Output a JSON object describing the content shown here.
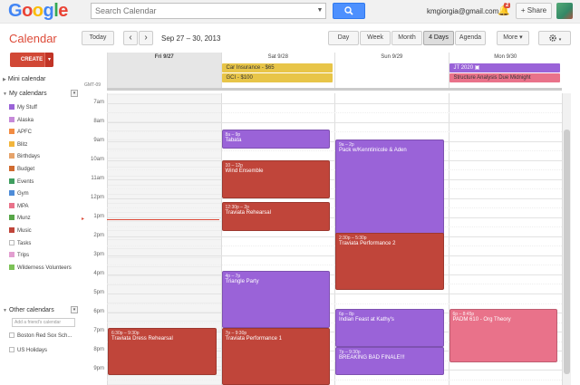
{
  "colors": {
    "purple": "#9a63d8",
    "red": "#c0453a",
    "pink": "#e9728a",
    "gold": "#e8c548",
    "accent": "#dd4b39"
  },
  "topbar": {
    "search_placeholder": "Search Calendar",
    "search_icon": "search-icon",
    "email": "kmgiorgia@gmail.com",
    "notification_count": "2",
    "share_label": "+ Share"
  },
  "toolbar": {
    "app_name": "Calendar",
    "today_label": "Today",
    "prev": "‹",
    "next": "›",
    "date_range": "Sep 27 – 30, 2013",
    "views": [
      "Day",
      "Week",
      "Month",
      "4 Days",
      "Agenda"
    ],
    "active_view": "4 Days",
    "more_label": "More ▾",
    "settings_icon": "gear-icon"
  },
  "sidebar": {
    "create_label": "CREATE",
    "mini_calendar_label": "Mini calendar",
    "my_calendars_label": "My calendars",
    "my_calendars": [
      {
        "name": "My Stuff",
        "color": "#9a63d8"
      },
      {
        "name": "Alaska",
        "color": "#c68ad9"
      },
      {
        "name": "APFC",
        "color": "#f28c43"
      },
      {
        "name": "Blitz",
        "color": "#f2b53b"
      },
      {
        "name": "Birthdays",
        "color": "#e6a36a"
      },
      {
        "name": "Budget",
        "color": "#d06b30"
      },
      {
        "name": "Events",
        "color": "#3f9e5f"
      },
      {
        "name": "Gym",
        "color": "#4e8cd8"
      },
      {
        "name": "MPA",
        "color": "#e9728a"
      },
      {
        "name": "Munz",
        "color": "#57a648"
      },
      {
        "name": "Music",
        "color": "#c0453a"
      },
      {
        "name": "Tasks",
        "color": ""
      },
      {
        "name": "Trips",
        "color": "#e29ed0"
      },
      {
        "name": "Wilderness Volunteers",
        "color": "#7cc257"
      }
    ],
    "other_calendars_label": "Other calendars",
    "friend_placeholder": "Add a friend's calendar",
    "other_calendars": [
      {
        "name": "Boston Red Sox Sch..."
      },
      {
        "name": "US Holidays"
      }
    ]
  },
  "calendar": {
    "gmt_label": "GMT-09",
    "days": [
      {
        "label": "Fri 9/27",
        "today": true
      },
      {
        "label": "Sat 9/28",
        "today": false
      },
      {
        "label": "Sun 9/29",
        "today": false
      },
      {
        "label": "Mon 9/30",
        "today": false
      }
    ],
    "allday_events": [
      {
        "day": 1,
        "row": 0,
        "title": "Car Insurance - $65",
        "color": "#e8c548",
        "text": "#333"
      },
      {
        "day": 1,
        "row": 1,
        "title": "GCI - $100",
        "color": "#e8c548",
        "text": "#333"
      },
      {
        "day": 3,
        "row": 0,
        "title": "JT 2020 ▣",
        "color": "#9a63d8",
        "text": "#fff"
      },
      {
        "day": 3,
        "row": 1,
        "title": "Structure Analysis Due Midnight",
        "color": "#e9728a",
        "text": "#333"
      }
    ],
    "hours": [
      "7am",
      "8am",
      "9am",
      "10am",
      "11am",
      "12pm",
      "1pm",
      "2pm",
      "3pm",
      "4pm",
      "5pm",
      "6pm",
      "7pm",
      "8pm",
      "9pm"
    ],
    "start_hour": 6.5,
    "end_hour": 21.8,
    "now_hour": 13.1,
    "events": [
      {
        "day": 1,
        "start": 8.4,
        "end": 9.4,
        "time": "8a – 9p",
        "title": "Tabata",
        "color": "#9a63d8"
      },
      {
        "day": 2,
        "start": 8.9,
        "end": 14.0,
        "time": "9a – 2p",
        "title": "Pack w/Kenntinicole & Aden",
        "color": "#9a63d8"
      },
      {
        "day": 1,
        "start": 10.0,
        "end": 12.0,
        "time": "10 – 12p",
        "title": "Wind Ensemble",
        "color": "#c0453a"
      },
      {
        "day": 1,
        "start": 12.2,
        "end": 13.7,
        "time": "12:30p – 2p",
        "title": "Traviata Rehearsal",
        "color": "#c0453a"
      },
      {
        "day": 2,
        "start": 13.8,
        "end": 16.8,
        "time": "2:30p – 5:30p",
        "title": "Traviata Performance 2",
        "color": "#c0453a"
      },
      {
        "day": 1,
        "start": 15.8,
        "end": 18.8,
        "time": "4p – 7p",
        "title": "Triangle Party",
        "color": "#9a63d8"
      },
      {
        "day": 2,
        "start": 17.8,
        "end": 19.8,
        "time": "6p – 8p",
        "title": "Indian Feast at Kathy's",
        "color": "#9a63d8"
      },
      {
        "day": 3,
        "start": 17.8,
        "end": 20.6,
        "time": "6p – 8:45p",
        "title": "PADM 610 - Org Theory",
        "color": "#e9728a"
      },
      {
        "day": 0,
        "start": 18.8,
        "end": 21.3,
        "time": "6:30p – 9:30p",
        "title": "Traviata Dress Rehearsal",
        "color": "#c0453a"
      },
      {
        "day": 1,
        "start": 18.8,
        "end": 21.8,
        "time": "7p – 9:30p",
        "title": "Traviata Performance 1",
        "color": "#c0453a"
      },
      {
        "day": 2,
        "start": 19.8,
        "end": 21.3,
        "time": "7p – 9:30p",
        "title": "BREAKING BAD FINALE!!!",
        "color": "#9a63d8"
      }
    ]
  }
}
